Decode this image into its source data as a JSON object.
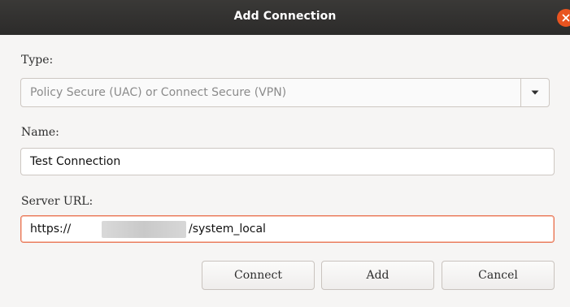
{
  "window": {
    "title": "Add Connection",
    "close_icon": "close-icon",
    "close_color": "#e95420"
  },
  "type_field": {
    "label": "Type:",
    "selected": "Policy Secure (UAC) or Connect Secure (VPN)",
    "dropdown_icon": "chevron-down-icon"
  },
  "name_field": {
    "label": "Name:",
    "value": "Test Connection"
  },
  "server_field": {
    "label": "Server URL:",
    "value_prefix": "https://",
    "value_suffix": "/system_local"
  },
  "buttons": {
    "connect": "Connect",
    "add": "Add",
    "cancel": "Cancel"
  }
}
